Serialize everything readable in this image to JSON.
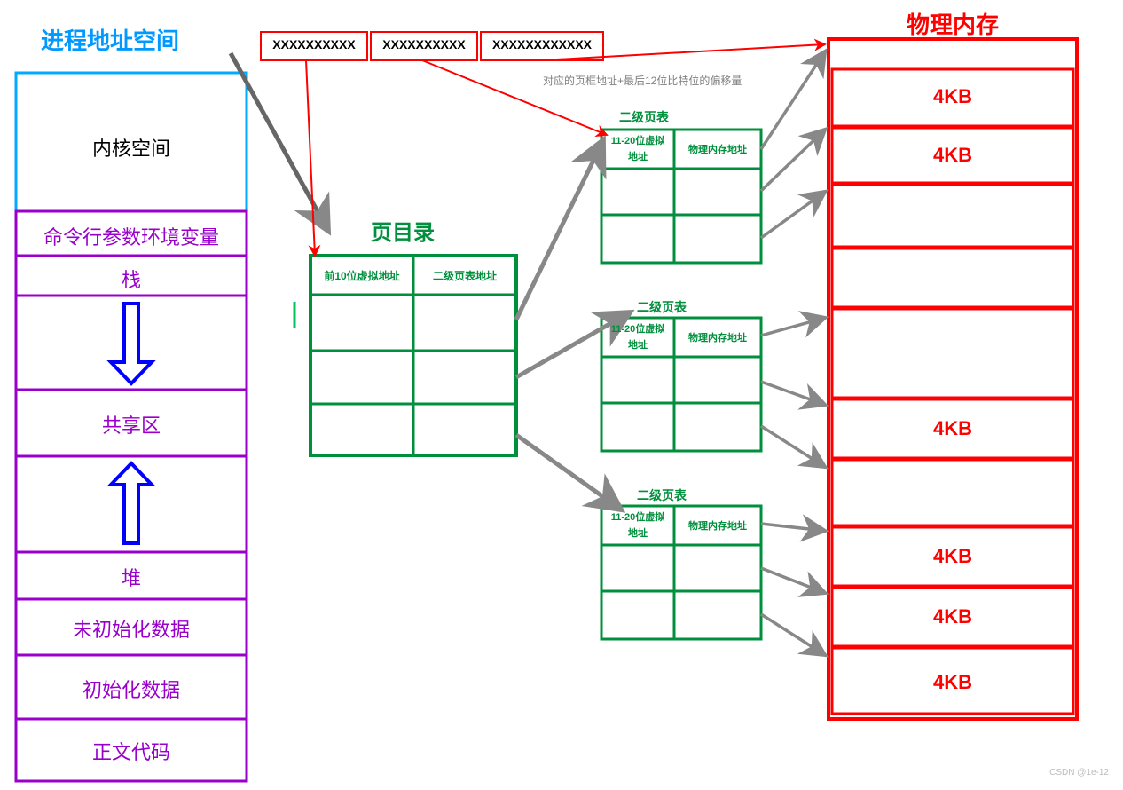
{
  "titles": {
    "left": "进程地址空间",
    "right": "物理内存",
    "pageDir": "页目录",
    "l2a": "二级页表",
    "l2b": "二级页表",
    "l2c": "二级页表"
  },
  "addrBits": {
    "p1": "XXXXXXXXXX",
    "p2": "XXXXXXXXXX",
    "p3": "XXXXXXXXXXXX"
  },
  "note": "对应的页框地址+最后12位比特位的偏移量",
  "addrSpace": {
    "kernel": "内核空间",
    "env": "命令行参数环境变量",
    "stack": "栈",
    "shared": "共享区",
    "heap": "堆",
    "bss": "未初始化数据",
    "data": "初始化数据",
    "text": "正文代码"
  },
  "pageDir": {
    "h1": "前10位虚拟地址",
    "h2": "二级页表地址"
  },
  "l2": {
    "h1top": "11-20位虚拟",
    "h1bot": "地址",
    "h2": "物理内存地址"
  },
  "phys": {
    "size": "4KB"
  },
  "watermark": "CSDN @1e-12"
}
